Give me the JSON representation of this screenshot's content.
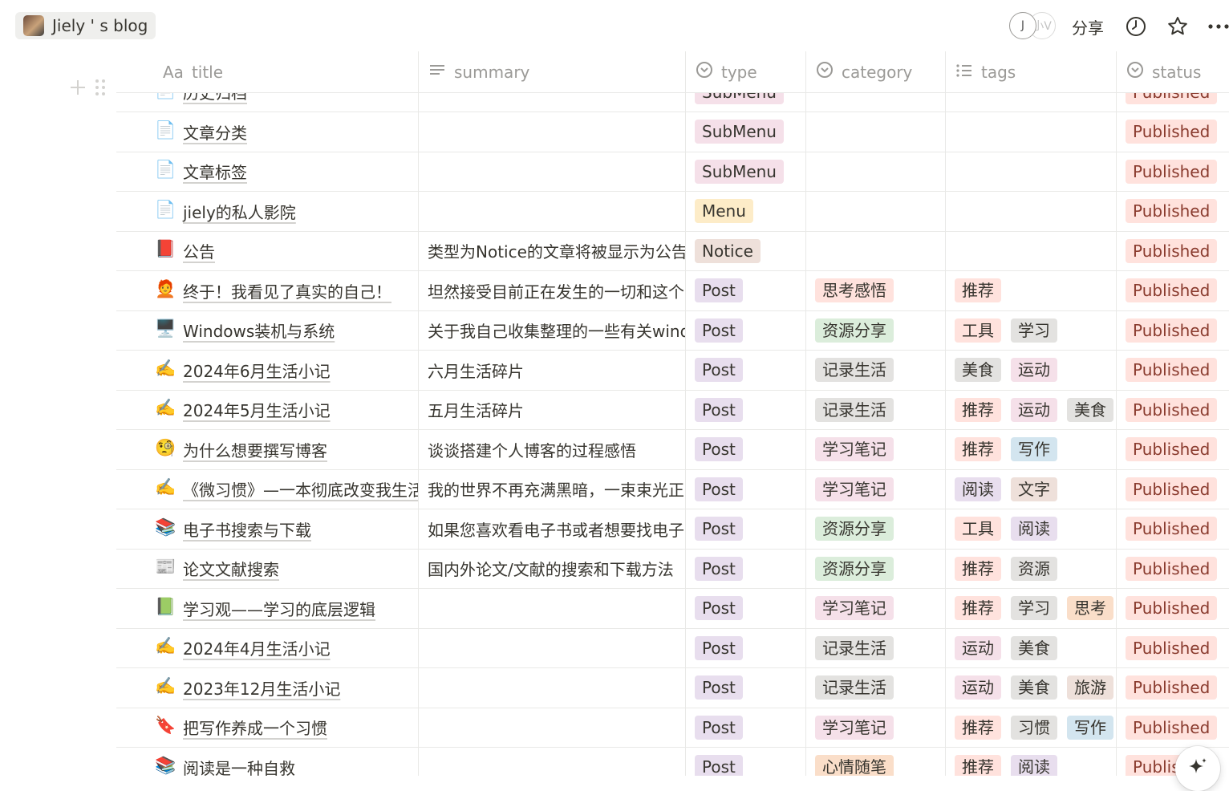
{
  "workspace": {
    "name": "Jiely ' s blog"
  },
  "toolbar": {
    "avatar_initial": "J",
    "avatar_second": "小V",
    "share_label": "分享"
  },
  "columns": [
    {
      "key": "title",
      "label": "title",
      "icon": "Aa-text-icon"
    },
    {
      "key": "summary",
      "label": "summary",
      "icon": "lines-icon"
    },
    {
      "key": "type",
      "label": "type",
      "icon": "select-icon"
    },
    {
      "key": "category",
      "label": "category",
      "icon": "select-icon"
    },
    {
      "key": "tags",
      "label": "tags",
      "icon": "multiselect-icon"
    },
    {
      "key": "status",
      "label": "status",
      "icon": "select-icon"
    }
  ],
  "colors": {
    "pink": "#f5e0e9",
    "purple": "#e8deee",
    "green": "#dbeddb",
    "gray": "#e3e2e0",
    "yellow": "#fdecc8",
    "brown": "#eee0da",
    "red": "#ffe2dd",
    "blue": "#d3e5ef",
    "orange": "#fadec9",
    "published": "#ffe2dd"
  },
  "rows": [
    {
      "emoji": "📄",
      "title": "历史归档",
      "summary": "",
      "type": {
        "label": "SubMenu",
        "color": "pink"
      },
      "category": null,
      "tags": [],
      "status": "Published"
    },
    {
      "emoji": "📄",
      "title": "文章分类",
      "summary": "",
      "type": {
        "label": "SubMenu",
        "color": "pink"
      },
      "category": null,
      "tags": [],
      "status": "Published"
    },
    {
      "emoji": "📄",
      "title": "文章标签",
      "summary": "",
      "type": {
        "label": "SubMenu",
        "color": "pink"
      },
      "category": null,
      "tags": [],
      "status": "Published"
    },
    {
      "emoji": "📄",
      "title": "jiely的私人影院",
      "summary": "",
      "type": {
        "label": "Menu",
        "color": "yellow"
      },
      "category": null,
      "tags": [],
      "status": "Published"
    },
    {
      "emoji": "📕",
      "title": "公告",
      "summary": "类型为Notice的文章将被显示为公告",
      "type": {
        "label": "Notice",
        "color": "brown"
      },
      "category": null,
      "tags": [],
      "status": "Published"
    },
    {
      "emoji": "🧑‍🦰",
      "title": "终于！我看见了真实的自己！",
      "summary": "坦然接受目前正在发生的一切和这个",
      "type": {
        "label": "Post",
        "color": "purple"
      },
      "category": {
        "label": "思考感悟",
        "color": "red"
      },
      "tags": [
        {
          "label": "推荐",
          "color": "red"
        }
      ],
      "status": "Published"
    },
    {
      "emoji": "🖥️",
      "title": "Windows装机与系统",
      "summary": "关于我自己收集整理的一些有关windows",
      "type": {
        "label": "Post",
        "color": "purple"
      },
      "category": {
        "label": "资源分享",
        "color": "green"
      },
      "tags": [
        {
          "label": "工具",
          "color": "red"
        },
        {
          "label": "学习",
          "color": "gray"
        }
      ],
      "status": "Published"
    },
    {
      "emoji": "✍️",
      "title": "2024年6月生活小记",
      "summary": "六月生活碎片",
      "type": {
        "label": "Post",
        "color": "purple"
      },
      "category": {
        "label": "记录生活",
        "color": "gray"
      },
      "tags": [
        {
          "label": "美食",
          "color": "gray"
        },
        {
          "label": "运动",
          "color": "pink"
        }
      ],
      "status": "Published"
    },
    {
      "emoji": "✍️",
      "title": "2024年5月生活小记",
      "summary": "五月生活碎片",
      "type": {
        "label": "Post",
        "color": "purple"
      },
      "category": {
        "label": "记录生活",
        "color": "gray"
      },
      "tags": [
        {
          "label": "推荐",
          "color": "red"
        },
        {
          "label": "运动",
          "color": "pink"
        },
        {
          "label": "美食",
          "color": "gray"
        }
      ],
      "status": "Published"
    },
    {
      "emoji": "🧐",
      "title": "为什么想要撰写博客",
      "summary": "谈谈搭建个人博客的过程感悟",
      "type": {
        "label": "Post",
        "color": "purple"
      },
      "category": {
        "label": "学习笔记",
        "color": "pink"
      },
      "tags": [
        {
          "label": "推荐",
          "color": "red"
        },
        {
          "label": "写作",
          "color": "blue"
        }
      ],
      "status": "Published"
    },
    {
      "emoji": "✍️",
      "title": "《微习惯》—一本彻底改变我生活的书",
      "summary": "我的世界不再充满黑暗，一束束光正",
      "type": {
        "label": "Post",
        "color": "purple"
      },
      "category": {
        "label": "学习笔记",
        "color": "pink"
      },
      "tags": [
        {
          "label": "阅读",
          "color": "purple"
        },
        {
          "label": "文字",
          "color": "brown"
        }
      ],
      "status": "Published"
    },
    {
      "emoji": "📚",
      "title": "电子书搜索与下载",
      "summary": "如果您喜欢看电子书或者想要找电子书",
      "type": {
        "label": "Post",
        "color": "purple"
      },
      "category": {
        "label": "资源分享",
        "color": "green"
      },
      "tags": [
        {
          "label": "工具",
          "color": "red"
        },
        {
          "label": "阅读",
          "color": "purple"
        }
      ],
      "status": "Published"
    },
    {
      "emoji": "📰",
      "title": "论文文献搜索",
      "summary": "国内外论文/文献的搜索和下载方法",
      "type": {
        "label": "Post",
        "color": "purple"
      },
      "category": {
        "label": "资源分享",
        "color": "green"
      },
      "tags": [
        {
          "label": "推荐",
          "color": "red"
        },
        {
          "label": "资源",
          "color": "gray"
        }
      ],
      "status": "Published"
    },
    {
      "emoji": "📗",
      "title": "学习观——学习的底层逻辑",
      "summary": "",
      "type": {
        "label": "Post",
        "color": "purple"
      },
      "category": {
        "label": "学习笔记",
        "color": "pink"
      },
      "tags": [
        {
          "label": "推荐",
          "color": "red"
        },
        {
          "label": "学习",
          "color": "gray"
        },
        {
          "label": "思考",
          "color": "orange"
        }
      ],
      "status": "Published"
    },
    {
      "emoji": "✍️",
      "title": "2024年4月生活小记",
      "summary": "",
      "type": {
        "label": "Post",
        "color": "purple"
      },
      "category": {
        "label": "记录生活",
        "color": "gray"
      },
      "tags": [
        {
          "label": "运动",
          "color": "pink"
        },
        {
          "label": "美食",
          "color": "gray"
        }
      ],
      "status": "Published"
    },
    {
      "emoji": "✍️",
      "title": "2023年12月生活小记",
      "summary": "",
      "type": {
        "label": "Post",
        "color": "purple"
      },
      "category": {
        "label": "记录生活",
        "color": "gray"
      },
      "tags": [
        {
          "label": "运动",
          "color": "pink"
        },
        {
          "label": "美食",
          "color": "gray"
        },
        {
          "label": "旅游",
          "color": "brown"
        }
      ],
      "status": "Published"
    },
    {
      "emoji": "🔖",
      "title": "把写作养成一个习惯",
      "summary": "",
      "type": {
        "label": "Post",
        "color": "purple"
      },
      "category": {
        "label": "学习笔记",
        "color": "pink"
      },
      "tags": [
        {
          "label": "推荐",
          "color": "red"
        },
        {
          "label": "习惯",
          "color": "gray"
        },
        {
          "label": "写作",
          "color": "blue"
        }
      ],
      "status": "Published"
    },
    {
      "emoji": "📚",
      "title": "阅读是一种自救",
      "summary": "",
      "type": {
        "label": "Post",
        "color": "purple"
      },
      "category": {
        "label": "心情随笔",
        "color": "orange"
      },
      "tags": [
        {
          "label": "推荐",
          "color": "red"
        },
        {
          "label": "阅读",
          "color": "purple"
        }
      ],
      "status": "Published"
    }
  ]
}
